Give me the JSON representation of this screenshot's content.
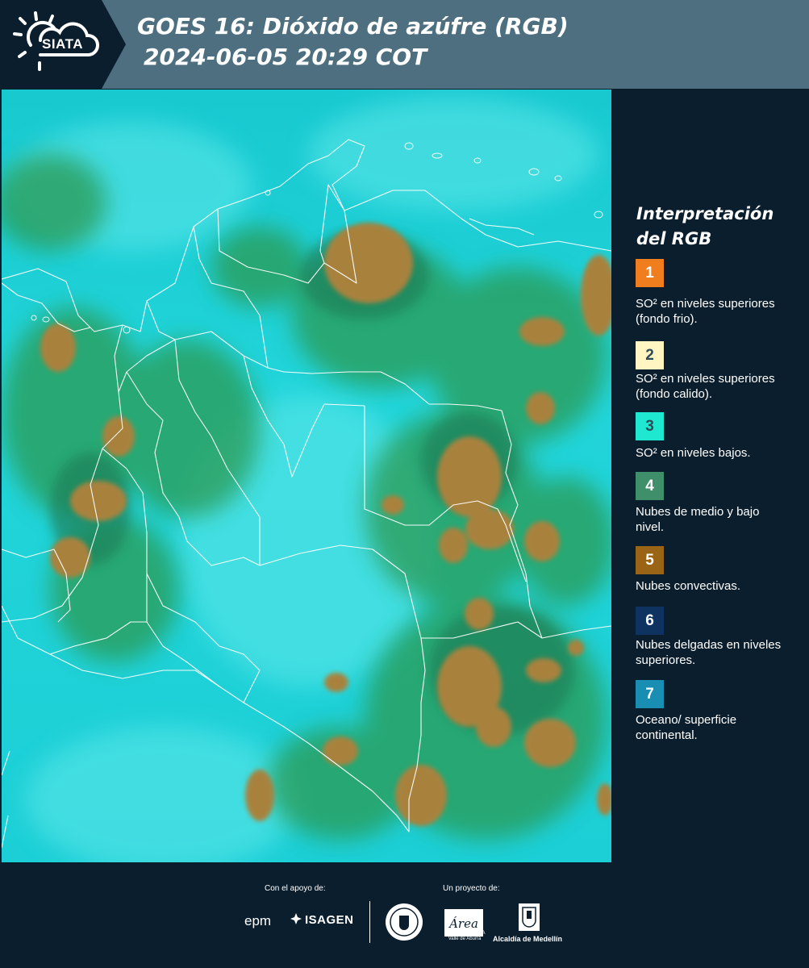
{
  "header": {
    "logo_text": "SIATA",
    "title_line1": "GOES 16: Dióxido de azúfre (RGB)",
    "title_line2": "2024-06-05 20:29 COT"
  },
  "map": {
    "icon": "satellite-map-image",
    "colors": {
      "background_cyan": "#1fd3d7",
      "cloud_green": "#2f9a4a",
      "convective_brown": "#a37a35",
      "borders": "#ffffff"
    }
  },
  "legend": {
    "title": "Interpretación del RGB",
    "items": [
      {
        "number": "1",
        "color": "#f07d1e",
        "text_color": "#ffffff",
        "label": "SO² en niveles superiores (fondo frio)."
      },
      {
        "number": "2",
        "color": "#fff5c2",
        "text_color": "#2a4a5a",
        "label": "SO² en niveles superiores (fondo calido)."
      },
      {
        "number": "3",
        "color": "#1ee8d0",
        "text_color": "#2a4a5a",
        "label": "SO² en niveles bajos."
      },
      {
        "number": "4",
        "color": "#3e8f6a",
        "text_color": "#ffffff",
        "label": "Nubes de medio y bajo nivel."
      },
      {
        "number": "5",
        "color": "#9a6417",
        "text_color": "#ffffff",
        "label": "Nubes convectivas."
      },
      {
        "number": "6",
        "color": "#0e3360",
        "text_color": "#ffffff",
        "label": "Nubes delgadas en niveles superiores."
      },
      {
        "number": "7",
        "color": "#1a8db3",
        "text_color": "#ffffff",
        "label": "Oceano/ superficie continental."
      }
    ]
  },
  "footer": {
    "support_label": "Con el apoyo de:",
    "project_label": "Un proyecto de:",
    "logos": {
      "epm": "epm",
      "isagen": "ISAGEN",
      "area_sub": "METROPOLITANA Valle de Aburrá",
      "alcaldia": "Alcaldía de Medellín"
    }
  }
}
